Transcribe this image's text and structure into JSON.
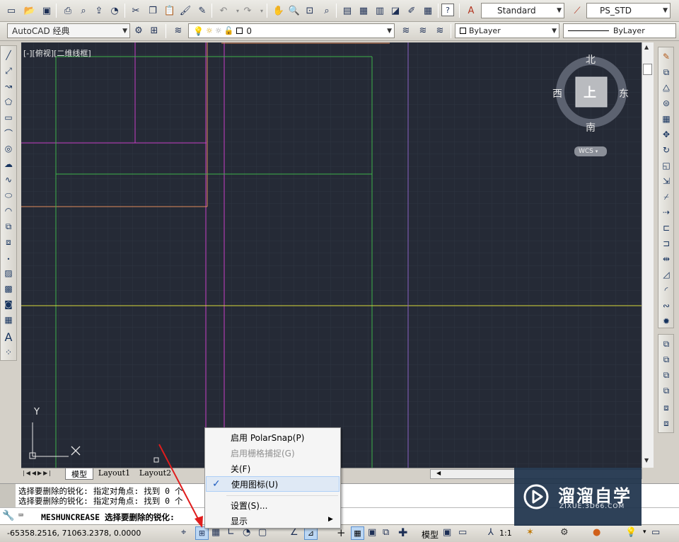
{
  "toolbar1": {
    "text_style": "Standard",
    "dim_style": "PS_STD"
  },
  "toolbar2": {
    "workspace": "AutoCAD 经典",
    "layer": "0",
    "color": "ByLayer",
    "linetype": "ByLayer"
  },
  "viewport": {
    "label": "[-][俯视][二维线框]",
    "ucs_y": "Y"
  },
  "viewcube": {
    "north": "北",
    "south": "南",
    "east": "东",
    "west": "西",
    "top": "上",
    "wcs": "WCS"
  },
  "tabs": [
    "模型",
    "Layout1",
    "Layout2"
  ],
  "context_menu": {
    "items": [
      {
        "label": "启用 PolarSnap(P)",
        "enabled": true
      },
      {
        "label": "启用栅格捕捉(G)",
        "enabled": false
      },
      {
        "label": "关(F)",
        "enabled": true
      },
      {
        "label": "使用图标(U)",
        "enabled": true,
        "checked": true
      },
      {
        "label": "设置(S)...",
        "enabled": true
      },
      {
        "label": "显示",
        "enabled": true,
        "submenu": true
      }
    ]
  },
  "command": {
    "history": [
      "选择要删除的锐化: 指定对角点: 找到 0 个",
      "选择要删除的锐化: 指定对角点: 找到 0 个"
    ],
    "prompt": "MESHUNCREASE 选择要删除的锐化:"
  },
  "status": {
    "coords": "-65358.2516, 71063.2378, 0.0000",
    "model": "模型",
    "scale": "1:1"
  },
  "watermark": {
    "title": "溜溜自学",
    "url": "ZIXUE.3D66.COM"
  },
  "colors": {
    "canvas": "#252a36",
    "grid": "#2f3542",
    "magenta": "#c63dc6",
    "green": "#3db34a",
    "yellow": "#d8d83a",
    "orange": "#e08a5a",
    "violet": "#8a63c7"
  }
}
